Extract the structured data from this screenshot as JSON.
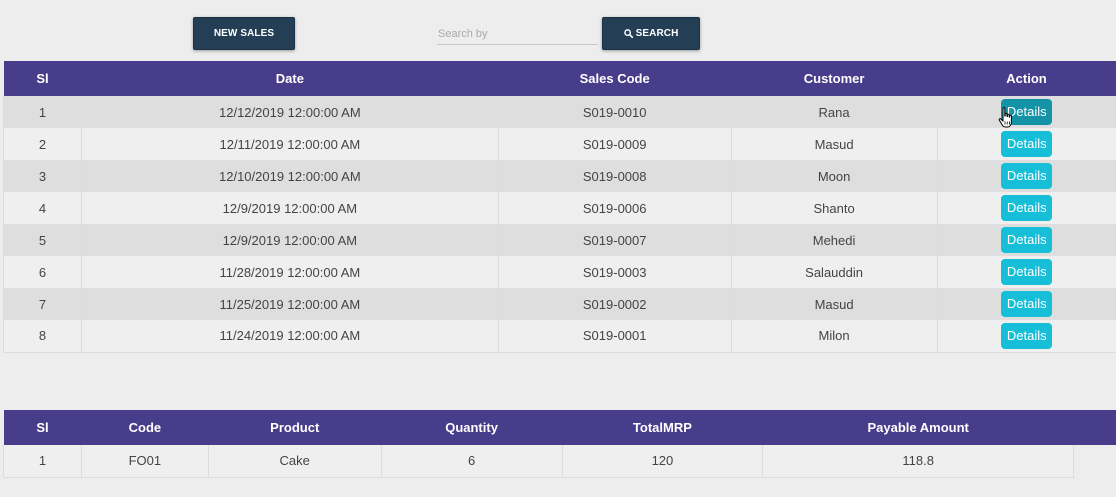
{
  "toolbar": {
    "new_sales_label": "NEW SALES",
    "search_placeholder": "Search by",
    "search_value": "",
    "search_label": "SEARCH",
    "button_color": "#243f55"
  },
  "sales_table": {
    "header_color": "#483d8b",
    "columns": [
      "Sl",
      "Date",
      "Sales Code",
      "Customer",
      "Action"
    ],
    "rows": [
      {
        "sl": "1",
        "date": "12/12/2019 12:00:00 AM",
        "code": "S019-0010",
        "customer": "Rana",
        "action": "Details"
      },
      {
        "sl": "2",
        "date": "12/11/2019 12:00:00 AM",
        "code": "S019-0009",
        "customer": "Masud",
        "action": "Details"
      },
      {
        "sl": "3",
        "date": "12/10/2019 12:00:00 AM",
        "code": "S019-0008",
        "customer": "Moon",
        "action": "Details"
      },
      {
        "sl": "4",
        "date": "12/9/2019 12:00:00 AM",
        "code": "S019-0006",
        "customer": "Shanto",
        "action": "Details"
      },
      {
        "sl": "5",
        "date": "12/9/2019 12:00:00 AM",
        "code": "S019-0007",
        "customer": "Mehedi",
        "action": "Details"
      },
      {
        "sl": "6",
        "date": "11/28/2019 12:00:00 AM",
        "code": "S019-0003",
        "customer": "Salauddin",
        "action": "Details"
      },
      {
        "sl": "7",
        "date": "11/25/2019 12:00:00 AM",
        "code": "S019-0002",
        "customer": "Masud",
        "action": "Details"
      },
      {
        "sl": "8",
        "date": "11/24/2019 12:00:00 AM",
        "code": "S019-0001",
        "customer": "Milon",
        "action": "Details"
      }
    ],
    "details_color": "#17bed8"
  },
  "product_table": {
    "columns": [
      "Sl",
      "Code",
      "Product",
      "Quantity",
      "TotalMRP",
      "Payable Amount"
    ],
    "rows": [
      {
        "sl": "1",
        "code": "FO01",
        "product": "Cake",
        "quantity": "6",
        "total_mrp": "120",
        "payable": "118.8"
      }
    ]
  },
  "icons": {
    "search": "search-icon",
    "cursor": "hand-pointer-icon"
  }
}
